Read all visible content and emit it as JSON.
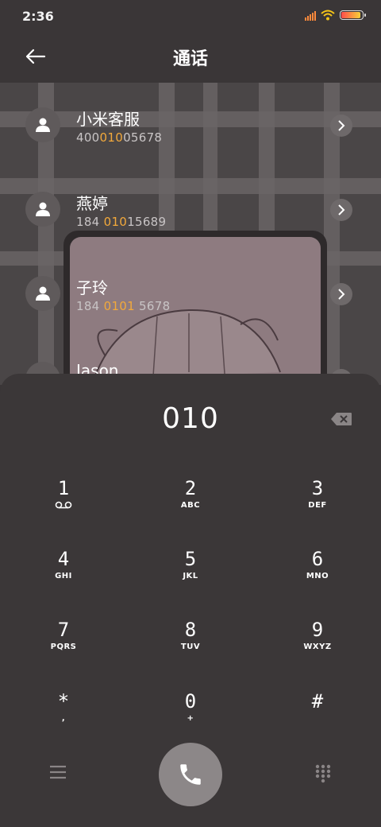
{
  "status_bar": {
    "time": "2:36"
  },
  "header": {
    "title": "通话"
  },
  "contacts": [
    {
      "name": "小米客服",
      "num_pre": "400",
      "num_hl": "010",
      "num_post": "05678"
    },
    {
      "name": "燕婷",
      "num_pre": "184 ",
      "num_hl": "010",
      "num_post": "15689"
    },
    {
      "name": "子玲",
      "num_pre": "184 ",
      "num_hl": "0101",
      "num_post": " 5678"
    },
    {
      "name": "Jason",
      "num_pre": "",
      "num_hl": "",
      "num_post": ""
    }
  ],
  "dialer": {
    "number": "010",
    "keys": [
      {
        "digit": "1",
        "letters": ""
      },
      {
        "digit": "2",
        "letters": "ABC"
      },
      {
        "digit": "3",
        "letters": "DEF"
      },
      {
        "digit": "4",
        "letters": "GHI"
      },
      {
        "digit": "5",
        "letters": "JKL"
      },
      {
        "digit": "6",
        "letters": "MNO"
      },
      {
        "digit": "7",
        "letters": "PQRS"
      },
      {
        "digit": "8",
        "letters": "TUV"
      },
      {
        "digit": "9",
        "letters": "WXYZ"
      },
      {
        "digit": "*",
        "letters": ","
      },
      {
        "digit": "0",
        "letters": "+"
      },
      {
        "digit": "#",
        "letters": ""
      }
    ]
  },
  "icons": {
    "voicemail": "voicemail-icon",
    "back": "back-arrow-icon",
    "backspace": "backspace-icon",
    "call": "phone-icon",
    "menu": "menu-icon",
    "keypad": "keypad-icon"
  },
  "colors": {
    "highlight": "#f2a93b",
    "sheet": "#3b3738",
    "call_button": "#8c8788"
  }
}
